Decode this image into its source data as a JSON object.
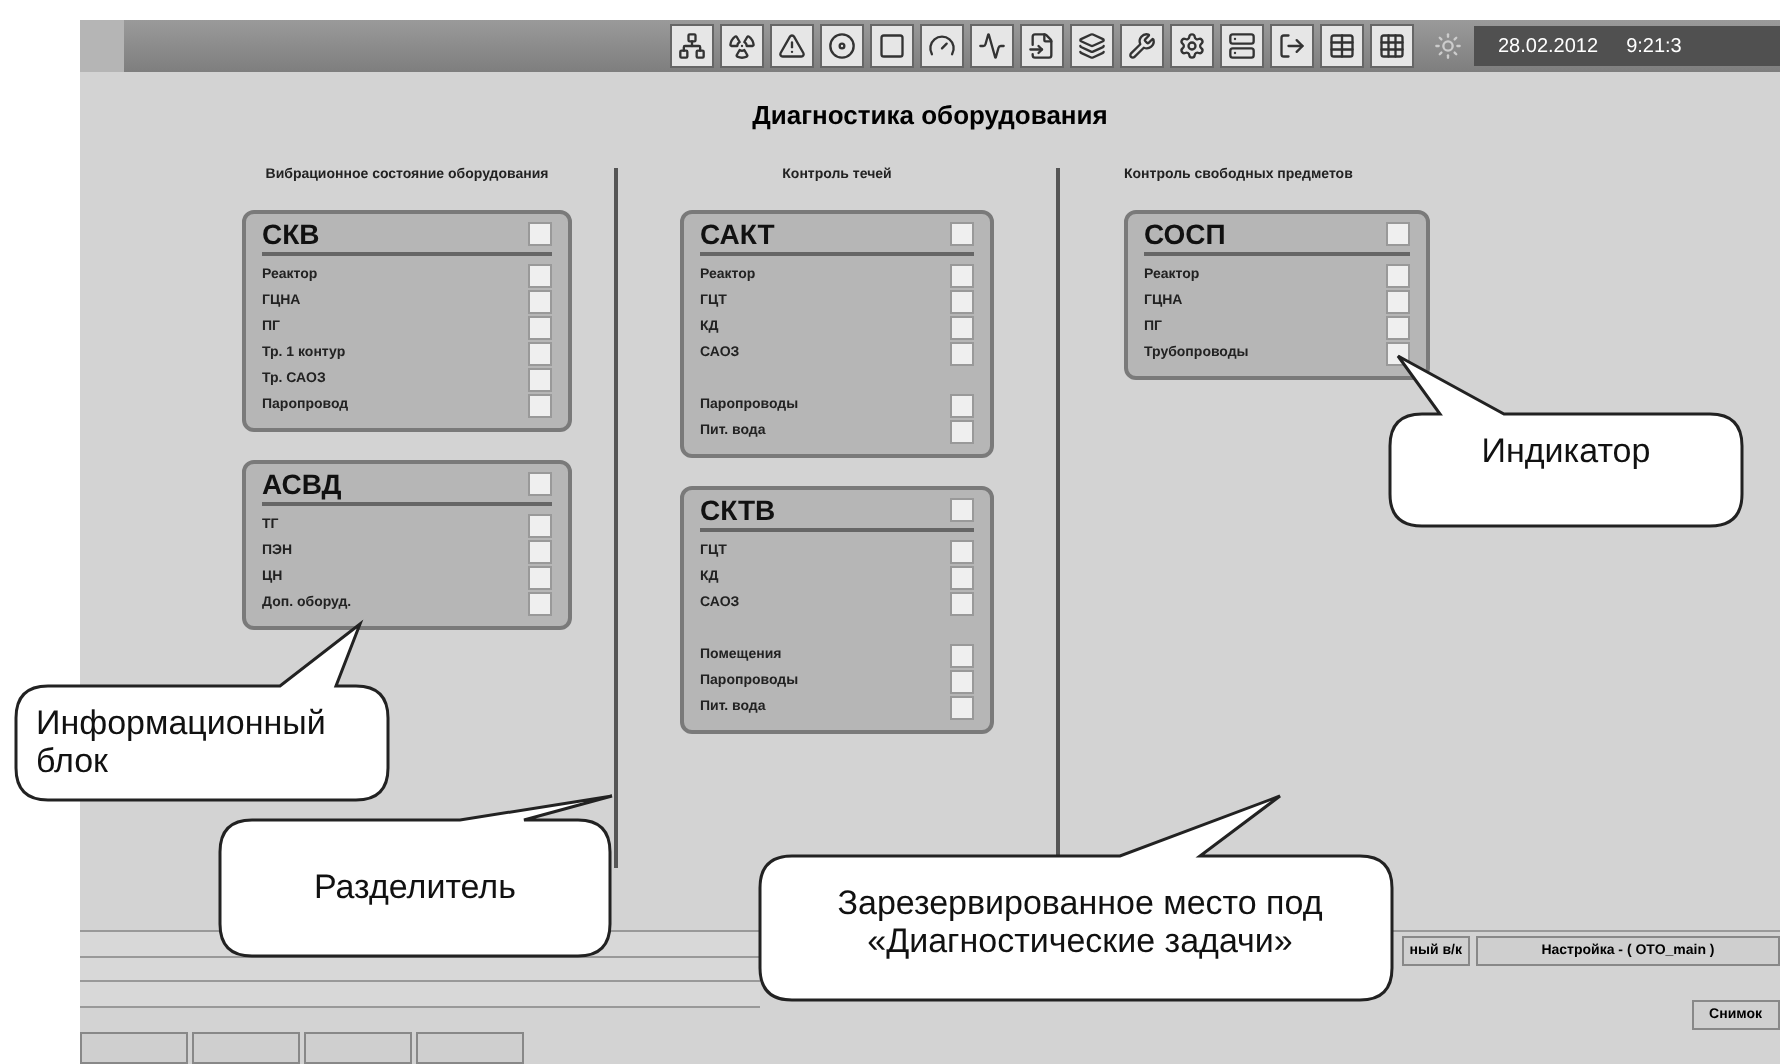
{
  "toolbar": {
    "date": "28.02.2012",
    "time": "9:21:3"
  },
  "title": "Диагностика оборудования",
  "columns": [
    {
      "heading": "Вибрационное состояние оборудования",
      "blocks": [
        {
          "title": "СКВ",
          "groups": [
            [
              "Реактор",
              "ГЦНА",
              "ПГ",
              "Тр. 1 контур",
              "Тр. САОЗ",
              "Паропровод"
            ]
          ]
        },
        {
          "title": "АСВД",
          "groups": [
            [
              "ТГ",
              "ПЭН",
              "ЦН",
              "Доп. оборуд."
            ]
          ]
        }
      ]
    },
    {
      "heading": "Контроль течей",
      "blocks": [
        {
          "title": "САКТ",
          "groups": [
            [
              "Реактор",
              "ГЦТ",
              "КД",
              "САОЗ"
            ],
            [
              "Паропроводы",
              "Пит. вода"
            ]
          ]
        },
        {
          "title": "СКТВ",
          "groups": [
            [
              "ГЦТ",
              "КД",
              "САОЗ"
            ],
            [
              "Помещения",
              "Паропроводы",
              "Пит. вода"
            ]
          ]
        }
      ]
    },
    {
      "heading": "Контроль свободных предметов",
      "blocks": [
        {
          "title": "СОСП",
          "groups": [
            [
              "Реактор",
              "ГЦНА",
              "ПГ",
              "Трубопроводы"
            ]
          ]
        }
      ]
    }
  ],
  "status_bar": {
    "panel_buttons": [
      "ный в/к",
      "Настройка - ( OTO_main )"
    ],
    "snapshot": "Снимок"
  },
  "callouts": [
    {
      "text": "Информационный блок"
    },
    {
      "text": "Разделитель"
    },
    {
      "text": "Зарезервированное место под «Диагностические  задачи»"
    },
    {
      "text": "Индикатор"
    }
  ]
}
